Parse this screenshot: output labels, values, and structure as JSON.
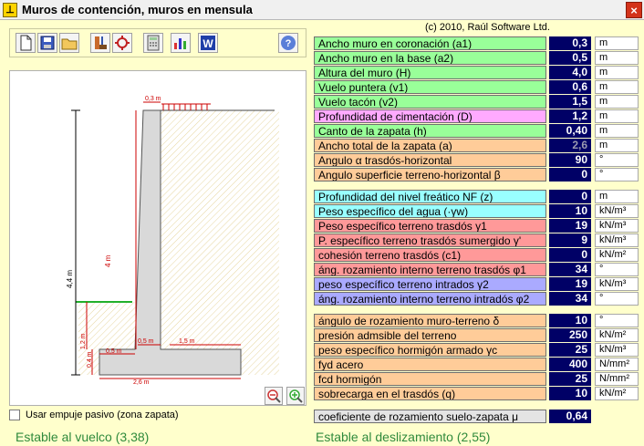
{
  "window": {
    "title": "Muros de contención, muros en mensula",
    "close_icon": "×"
  },
  "copyright": "(c) 2010, Raúl Software Ltd.",
  "toolbar": [
    "new-document-icon",
    "save-icon",
    "open-folder-icon",
    "wall-icon",
    "settings-icon",
    "calculator-icon",
    "bar-chart-icon",
    "word-icon",
    "help-icon"
  ],
  "drawing": {
    "labels": {
      "a1": "0,3 m",
      "H": "4 m",
      "total": "4,4 m",
      "D": "1,2 m",
      "v1": "0,5 m",
      "v2": "1,5 m",
      "a2": "0,5 m",
      "h": "0,4 m",
      "a": "2,6 m"
    }
  },
  "checkbox": {
    "label": "Usar empuje pasivo (zona zapata)",
    "checked": false
  },
  "status": {
    "vuelco": "Estable al vuelco (3,38)",
    "deslizamiento": "Estable al deslizamiento (2,55)"
  },
  "geometry_params": [
    {
      "label": "Ancho muro en coronación (a1)",
      "value": "0,3",
      "unit": "m",
      "color": "green"
    },
    {
      "label": "Ancho muro en la base (a2)",
      "value": "0,5",
      "unit": "m",
      "color": "green"
    },
    {
      "label": "Altura del muro (H)",
      "value": "4,0",
      "unit": "m",
      "color": "green"
    },
    {
      "label": "Vuelo puntera (v1)",
      "value": "0,6",
      "unit": "m",
      "color": "green"
    },
    {
      "label": "Vuelo tacón (v2)",
      "value": "1,5",
      "unit": "m",
      "color": "green"
    },
    {
      "label": "Profundidad de cimentación (D)",
      "value": "1,2",
      "unit": "m",
      "color": "pink"
    },
    {
      "label": "Canto de la zapata (h)",
      "value": "0,40",
      "unit": "m",
      "color": "green"
    },
    {
      "label": "Ancho total de la zapata (a)",
      "value": "2,6",
      "unit": "m",
      "color": "peach"
    },
    {
      "label": "Angulo  α  trasdós-horizontal",
      "value": "90",
      "unit": "°",
      "color": "peach"
    },
    {
      "label": "Angulo superficie terreno-horizontal   β",
      "value": "0",
      "unit": "°",
      "color": "peach"
    }
  ],
  "soil_params": [
    {
      "label": "Profundidad del nivel freático NF  (z)",
      "value": "0",
      "unit": "m",
      "color": "cyan"
    },
    {
      "label": "Peso específico del agua (·γw)",
      "value": "10",
      "unit": "kN/m³",
      "color": "cyan"
    },
    {
      "label": "Peso específico terreno trasdós  γ1",
      "value": "19",
      "unit": "kN/m³",
      "color": "salmon"
    },
    {
      "label": "P. específico terreno trasdós sumergido   γ'",
      "value": "9",
      "unit": "kN/m³",
      "color": "salmon"
    },
    {
      "label": "cohesión terreno trasdós  (c1)",
      "value": "0",
      "unit": "kN/m²",
      "color": "salmon"
    },
    {
      "label": "áng. rozamiento interno terreno trasdós     φ1",
      "value": "34",
      "unit": "°",
      "color": "salmon"
    },
    {
      "label": "peso específico terreno intrados γ2",
      "value": "19",
      "unit": "kN/m³",
      "color": "lav"
    },
    {
      "label": "áng. rozamiento interno terreno intradós   φ2",
      "value": "34",
      "unit": "°",
      "color": "lav"
    }
  ],
  "material_params": [
    {
      "label": "ángulo de rozamiento muro-terreno    δ",
      "value": "10",
      "unit": "°",
      "color": "peach"
    },
    {
      "label": "presión admsible del terreno",
      "value": "250",
      "unit": "kN/m²",
      "color": "peach"
    },
    {
      "label": "peso específico hormigón armado   γc",
      "value": "25",
      "unit": "kN/m³",
      "color": "peach"
    },
    {
      "label": "fyd acero",
      "value": "400",
      "unit": "N/mm²",
      "color": "peach"
    },
    {
      "label": "fcd hormigón",
      "value": "25",
      "unit": "N/mm²",
      "color": "peach"
    },
    {
      "label": "sobrecarga en el trasdós (q)",
      "value": "10",
      "unit": "kN/m²",
      "color": "peach"
    }
  ],
  "friction": {
    "label": "coeficiente de rozamiento suelo-zapata   μ",
    "value": "0,64"
  }
}
